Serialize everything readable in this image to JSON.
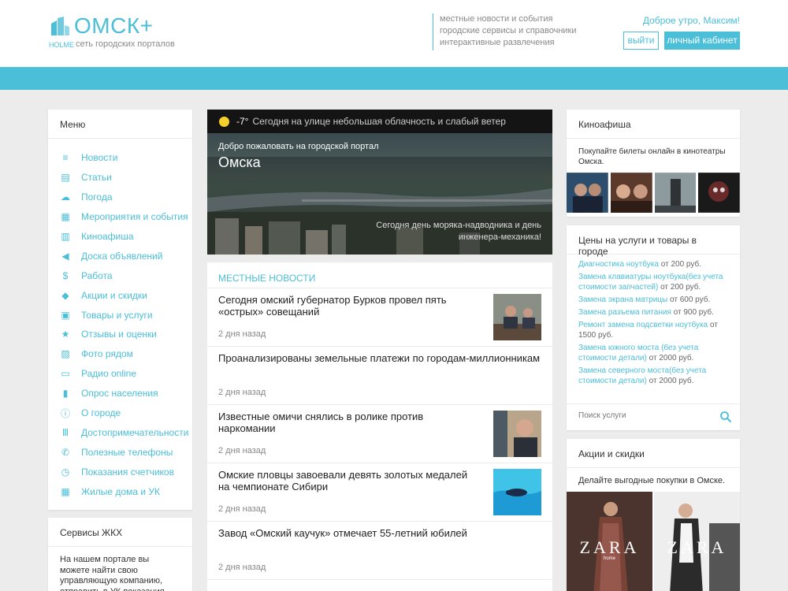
{
  "header": {
    "logo_title": "ОМСК+",
    "logo_brand": "HOLME",
    "logo_subtitle": "сеть городских порталов",
    "taglines": [
      "местные новости и события",
      "городские сервисы и справочники",
      "интерактивные развлечения"
    ],
    "greeting": "Доброе утро, Максим!",
    "logout_label": "выйти",
    "cabinet_label": "личный кабинет"
  },
  "colors": {
    "accent": "#4bbed8",
    "background": "#ececec",
    "dark_bar": "#141414",
    "sun": "#f6d02a"
  },
  "menu": {
    "title": "Меню",
    "items": [
      {
        "label": "Новости",
        "icon": "list-icon"
      },
      {
        "label": "Статьи",
        "icon": "document-icon"
      },
      {
        "label": "Погода",
        "icon": "cloud-icon"
      },
      {
        "label": "Мероприятия и события",
        "icon": "calendar-icon"
      },
      {
        "label": "Киноафиша",
        "icon": "film-icon"
      },
      {
        "label": "Доска объявлений",
        "icon": "megaphone-icon"
      },
      {
        "label": "Работа",
        "icon": "dollar-icon"
      },
      {
        "label": "Акции и скидки",
        "icon": "tag-icon"
      },
      {
        "label": "Товары и услуги",
        "icon": "bag-icon"
      },
      {
        "label": "Отзывы и оценки",
        "icon": "star-icon"
      },
      {
        "label": "Фото рядом",
        "icon": "image-icon"
      },
      {
        "label": "Радио online",
        "icon": "radio-icon"
      },
      {
        "label": "Опрос населения",
        "icon": "bar-chart-icon"
      },
      {
        "label": "О городе",
        "icon": "info-icon"
      },
      {
        "label": "Достопримечательности",
        "icon": "landmark-icon"
      },
      {
        "label": "Полезные телефоны",
        "icon": "phone-icon"
      },
      {
        "label": "Показания счетчиков",
        "icon": "gauge-icon"
      },
      {
        "label": "Жилые дома и УК",
        "icon": "building-icon"
      }
    ]
  },
  "zhkh": {
    "title": "Сервисы ЖКХ",
    "text": "На нашем портале вы можете найти свою управляющую компанию, отправить в УК показания счетчиков и"
  },
  "hero": {
    "temperature": "-7°",
    "weather": "Сегодня на улице небольшая облачность и слабый ветер",
    "welcome": "Добро пожаловать на городской портал",
    "city": "Омска",
    "event": "Сегодня день моряка-надводника и день инженера-механика!"
  },
  "news": {
    "title": "МЕСТНЫЕ НОВОСТИ",
    "items": [
      {
        "title": "Сегодня омский губернатор Бурков провел пять «острых» совещаний",
        "date": "2 дня назад"
      },
      {
        "title": "Проанализированы земельные платежи по городам-миллионникам",
        "date": "2 дня назад"
      },
      {
        "title": "Известные омичи снялись в ролике против наркомании",
        "date": "2 дня назад"
      },
      {
        "title": "Омские пловцы завоевали девять золотых медалей на чемпионате Сибири",
        "date": "2 дня назад"
      },
      {
        "title": "Завод «Омский каучук» отмечает 55-летний юбилей",
        "date": "2 дня назад"
      }
    ]
  },
  "kino": {
    "title": "Киноафиша",
    "text": "Покупайте билеты онлайн в кинотеатры Омска."
  },
  "prices": {
    "title": "Цены на услуги и товары в городе",
    "items": [
      {
        "service": "Диагностика ноутбука",
        "price": "от 200 руб."
      },
      {
        "service": "Замена клавиатуры ноутбука(без учета стоимости запчастей)",
        "price": "от 200 руб."
      },
      {
        "service": "Замена экрана матрицы",
        "price": "от 600 руб."
      },
      {
        "service": "Замена разъема питания",
        "price": "от 900 руб."
      },
      {
        "service": "Ремонт замена подсветки ноутбука",
        "price": "от 1500 руб."
      },
      {
        "service": "Замена южного моста (без учета стоимости детали)",
        "price": "от 2000 руб."
      },
      {
        "service": "Замена северного моста(без учета стоимости детали)",
        "price": "от 2000 руб."
      }
    ],
    "search_placeholder": "Поиск услуги"
  },
  "akcii": {
    "title": "Акции и скидки",
    "text": "Делайте выгодные покупки в Омске.",
    "ads": [
      {
        "brand": "ZARA",
        "sub": "home"
      },
      {
        "brand": "ZARA",
        "sub": ""
      }
    ]
  }
}
